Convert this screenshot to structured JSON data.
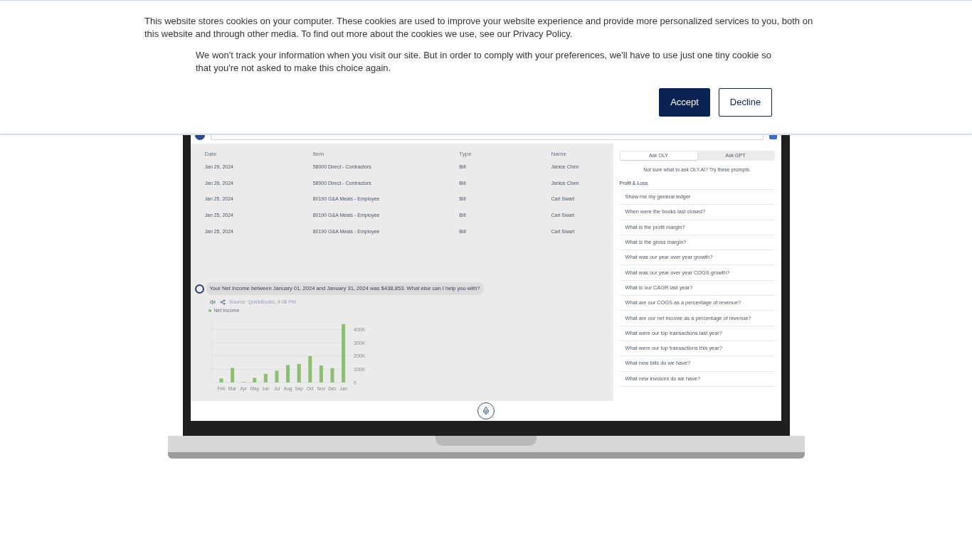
{
  "cookie_banner": {
    "message": "This website stores cookies on your computer. These cookies are used to improve your website experience and provide more personalized services to you, both on this website and through other media. To find out more about the cookies we use, see our Privacy Policy.",
    "notice": "We won't track your information when you visit our site. But in order to comply with your preferences, we'll have to use just one tiny cookie so that you're not asked to make this choice again.",
    "buttons": [
      {
        "label": "Accept",
        "kind": "primary"
      },
      {
        "label": "Decline",
        "kind": "secondary"
      }
    ]
  },
  "app": {
    "table": {
      "columns": [
        "Date",
        "Item",
        "Type",
        "Name"
      ],
      "rows": [
        [
          "Jan 29, 2024",
          "58000 Direct - Contractors",
          "Bill",
          "Janice Chen"
        ],
        [
          "Jan 26, 2024",
          "58000 Direct - Contractors",
          "Bill",
          "Janice Chen"
        ],
        [
          "Jan 25, 2024",
          "80190 G&A Meals - Employee",
          "Bill",
          "Carl Swart"
        ],
        [
          "Jan 25, 2024",
          "80190 G&A Meals - Employee",
          "Bill",
          "Carl Swart"
        ],
        [
          "Jan 25, 2024",
          "80190 G&A Meals - Employee",
          "Bill",
          "Carl Swart"
        ]
      ]
    },
    "chat": {
      "message": "Your Net Income between January 01, 2024 and January 31, 2024 was $438,853. What else can I help you with?",
      "source": "Source: QuickBooks, 4:08 PM",
      "chart_data": {
        "type": "bar",
        "categories": [
          "Feb",
          "Mar",
          "Apr",
          "May",
          "Jun",
          "Jul",
          "Aug",
          "Sep",
          "Oct",
          "Nov",
          "Dec",
          "Jan"
        ],
        "series": [
          {
            "name": "Net Income",
            "color": "#8dbf6f",
            "values": [
              30000,
              110000,
              5000,
              35000,
              65000,
              88000,
              132000,
              140000,
              200000,
              128000,
              108000,
              440000
            ]
          }
        ],
        "ylim": [
          0,
          450000
        ],
        "grid": true,
        "yticks": [
          {
            "value": 0,
            "label": "0"
          },
          {
            "value": 100000,
            "label": "100K"
          },
          {
            "value": 200000,
            "label": "200K"
          },
          {
            "value": 300000,
            "label": "300K"
          },
          {
            "value": 400000,
            "label": "400K"
          }
        ]
      }
    },
    "prompts_panel": {
      "tabs": [
        {
          "label": "Ask OLY",
          "selected": true
        },
        {
          "label": "Ask GPT",
          "selected": false
        }
      ],
      "hint": "Not sure what to ask OLY.AI? Try these prompts.",
      "section": "Profit & Loss",
      "prompts": [
        "Show me my general ledger",
        "When were the books last closed?",
        "What is the profit margin?",
        "What is the gross margin?",
        "What was our year over year growth?",
        "What was our year over year COGS growth?",
        "What is our CAGR last year?",
        "What are our COGS as a percentage of revenue?",
        "What are our net income as a percentage of revenue?",
        "What were our top transactions last year?",
        "What were our top transactions this year?",
        "What new bills do we have?",
        "What new invoices do we have?"
      ]
    }
  }
}
